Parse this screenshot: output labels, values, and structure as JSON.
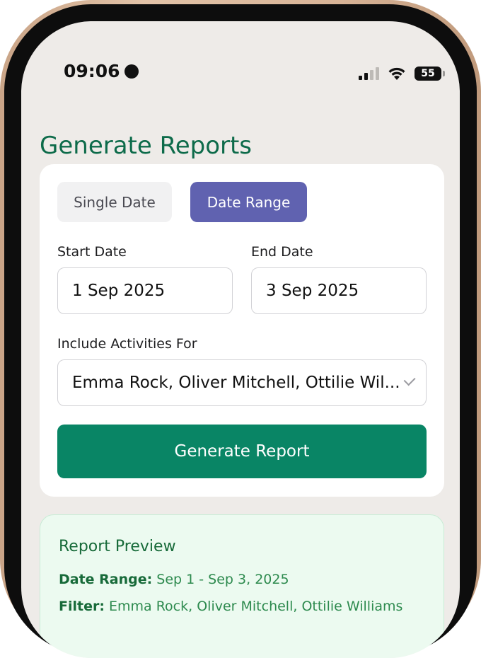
{
  "status": {
    "time": "09:06",
    "battery": "55"
  },
  "page": {
    "title": "Generate Reports"
  },
  "mode_toggle": {
    "single_label": "Single Date",
    "range_label": "Date Range",
    "selected": "range"
  },
  "form": {
    "start_label": "Start Date",
    "start_value": "1 Sep 2025",
    "end_label": "End Date",
    "end_value": "3 Sep 2025",
    "include_label": "Include Activities For",
    "include_value": "Emma Rock, Oliver Mitchell, Ottilie Wil...",
    "generate_label": "Generate Report"
  },
  "preview": {
    "title": "Report Preview",
    "date_range_key": "Date Range:",
    "date_range_value": "Sep 1 - Sep 3, 2025",
    "filter_key": "Filter:",
    "filter_value": "Emma Rock, Oliver Mitchell, Ottilie Williams"
  },
  "colors": {
    "title_green": "#0d6b4a",
    "accent_purple": "#6062b0",
    "button_green": "#098565",
    "preview_bg": "#ecfaf0"
  },
  "icons": [
    "record-dot-icon",
    "cellular-signal-icon",
    "wifi-icon",
    "battery-icon",
    "chevron-down-icon"
  ]
}
